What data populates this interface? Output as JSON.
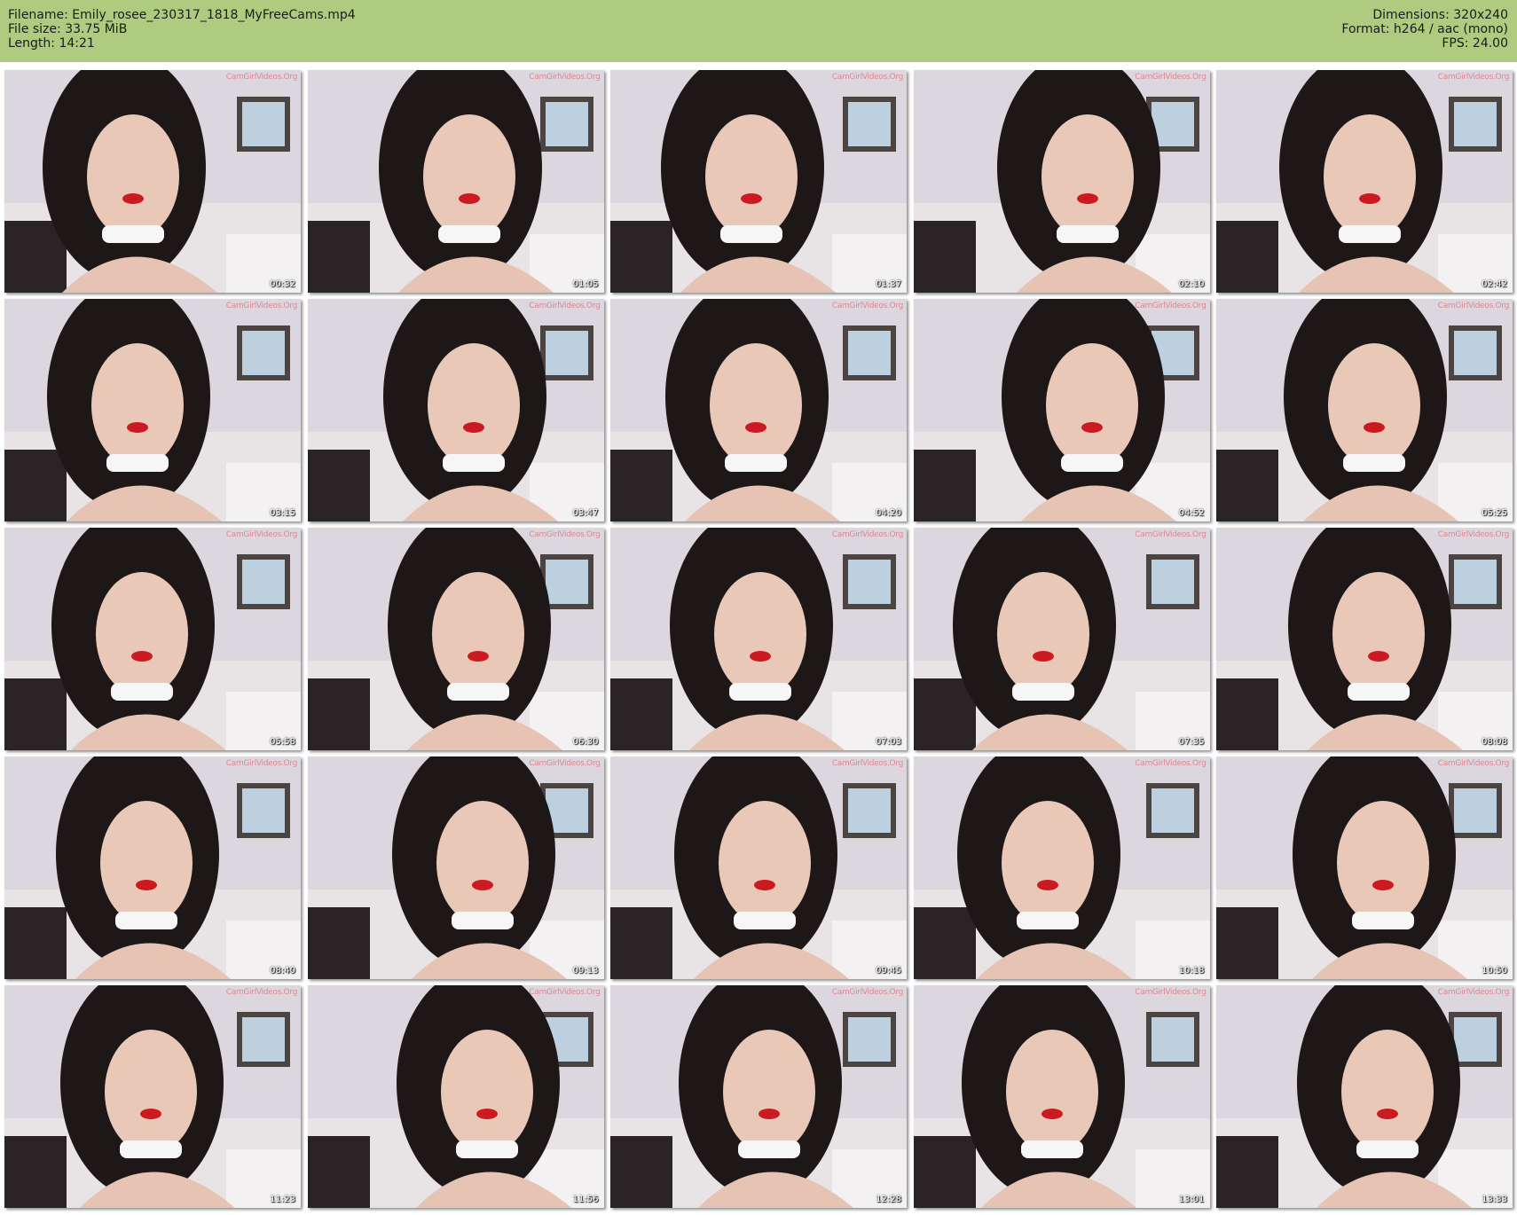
{
  "header": {
    "filename_line": "Filename: Emily_rosee_230317_1818_MyFreeCams.mp4",
    "filesize_line": "File size: 33.75 MiB",
    "length_line": "Length: 14:21",
    "dimensions_line": "Dimensions: 320x240",
    "format_line": "Format: h264 / aac (mono)",
    "fps_line": "FPS: 24.00",
    "background_color": "#aecb80"
  },
  "watermark": "CamGirlVideos.Org",
  "thumbnails": [
    {
      "timestamp": "00:32"
    },
    {
      "timestamp": "01:05"
    },
    {
      "timestamp": "01:37"
    },
    {
      "timestamp": "02:10"
    },
    {
      "timestamp": "02:42"
    },
    {
      "timestamp": "03:15"
    },
    {
      "timestamp": "03:47"
    },
    {
      "timestamp": "04:20"
    },
    {
      "timestamp": "04:52"
    },
    {
      "timestamp": "05:25"
    },
    {
      "timestamp": "05:58"
    },
    {
      "timestamp": "06:30"
    },
    {
      "timestamp": "07:03"
    },
    {
      "timestamp": "07:35"
    },
    {
      "timestamp": "08:08"
    },
    {
      "timestamp": "08:40"
    },
    {
      "timestamp": "09:13"
    },
    {
      "timestamp": "09:45"
    },
    {
      "timestamp": "10:18"
    },
    {
      "timestamp": "10:50"
    },
    {
      "timestamp": "11:23"
    },
    {
      "timestamp": "11:56"
    },
    {
      "timestamp": "12:28"
    },
    {
      "timestamp": "13:01"
    },
    {
      "timestamp": "13:33"
    }
  ]
}
